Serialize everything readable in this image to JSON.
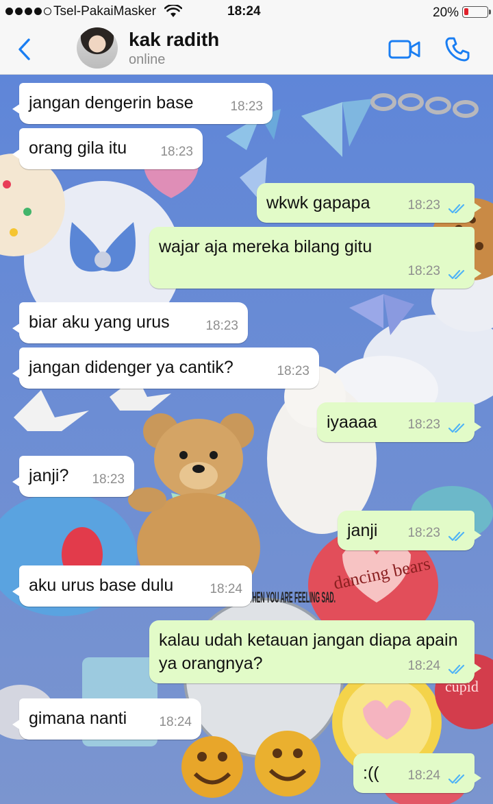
{
  "status_bar": {
    "carrier": "Tsel-PakaiMasker",
    "time": "18:24",
    "battery_percent": "20%",
    "battery_level": 0.2,
    "signal_bars_filled": 4,
    "signal_bars_total": 5
  },
  "header": {
    "contact_name": "kak radith",
    "contact_status": "online",
    "accent_color": "#1a7ef2"
  },
  "messages": [
    {
      "dir": "in",
      "text": "jangan dengerin base",
      "time": "18:23"
    },
    {
      "dir": "in",
      "text": "orang gila itu",
      "time": "18:23"
    },
    {
      "dir": "out",
      "text": "wkwk gapapa",
      "time": "18:23",
      "read": true
    },
    {
      "dir": "out",
      "text": "wajar aja mereka bilang gitu",
      "time": "18:23",
      "read": true
    },
    {
      "dir": "in",
      "text": "biar aku yang urus",
      "time": "18:23"
    },
    {
      "dir": "in",
      "text": "jangan didenger ya cantik?",
      "time": "18:23"
    },
    {
      "dir": "out",
      "text": "iyaaaa",
      "time": "18:23",
      "read": true
    },
    {
      "dir": "in",
      "text": "janji?",
      "time": "18:23"
    },
    {
      "dir": "out",
      "text": "janji",
      "time": "18:23",
      "read": true
    },
    {
      "dir": "in",
      "text": "aku urus base dulu",
      "time": "18:24"
    },
    {
      "dir": "out",
      "text": "kalau udah ketauan jangan diapa apain ya orangnya?",
      "time": "18:24",
      "read": true
    },
    {
      "dir": "in",
      "text": "gimana nanti",
      "time": "18:24"
    },
    {
      "dir": "out",
      "text": ":((",
      "time": "18:24",
      "read": true
    }
  ],
  "wallpaper": {
    "sticker_texts": [
      "dancing bears",
      "SONGS TO LISTEN WHEN YOU ARE FEELING SAD.",
      "cupid"
    ]
  },
  "colors": {
    "incoming_bubble": "#ffffff",
    "outgoing_bubble": "#e2fbc8",
    "read_ticks": "#4fb3f6",
    "wallpaper_sky": "#6f8ed4"
  }
}
